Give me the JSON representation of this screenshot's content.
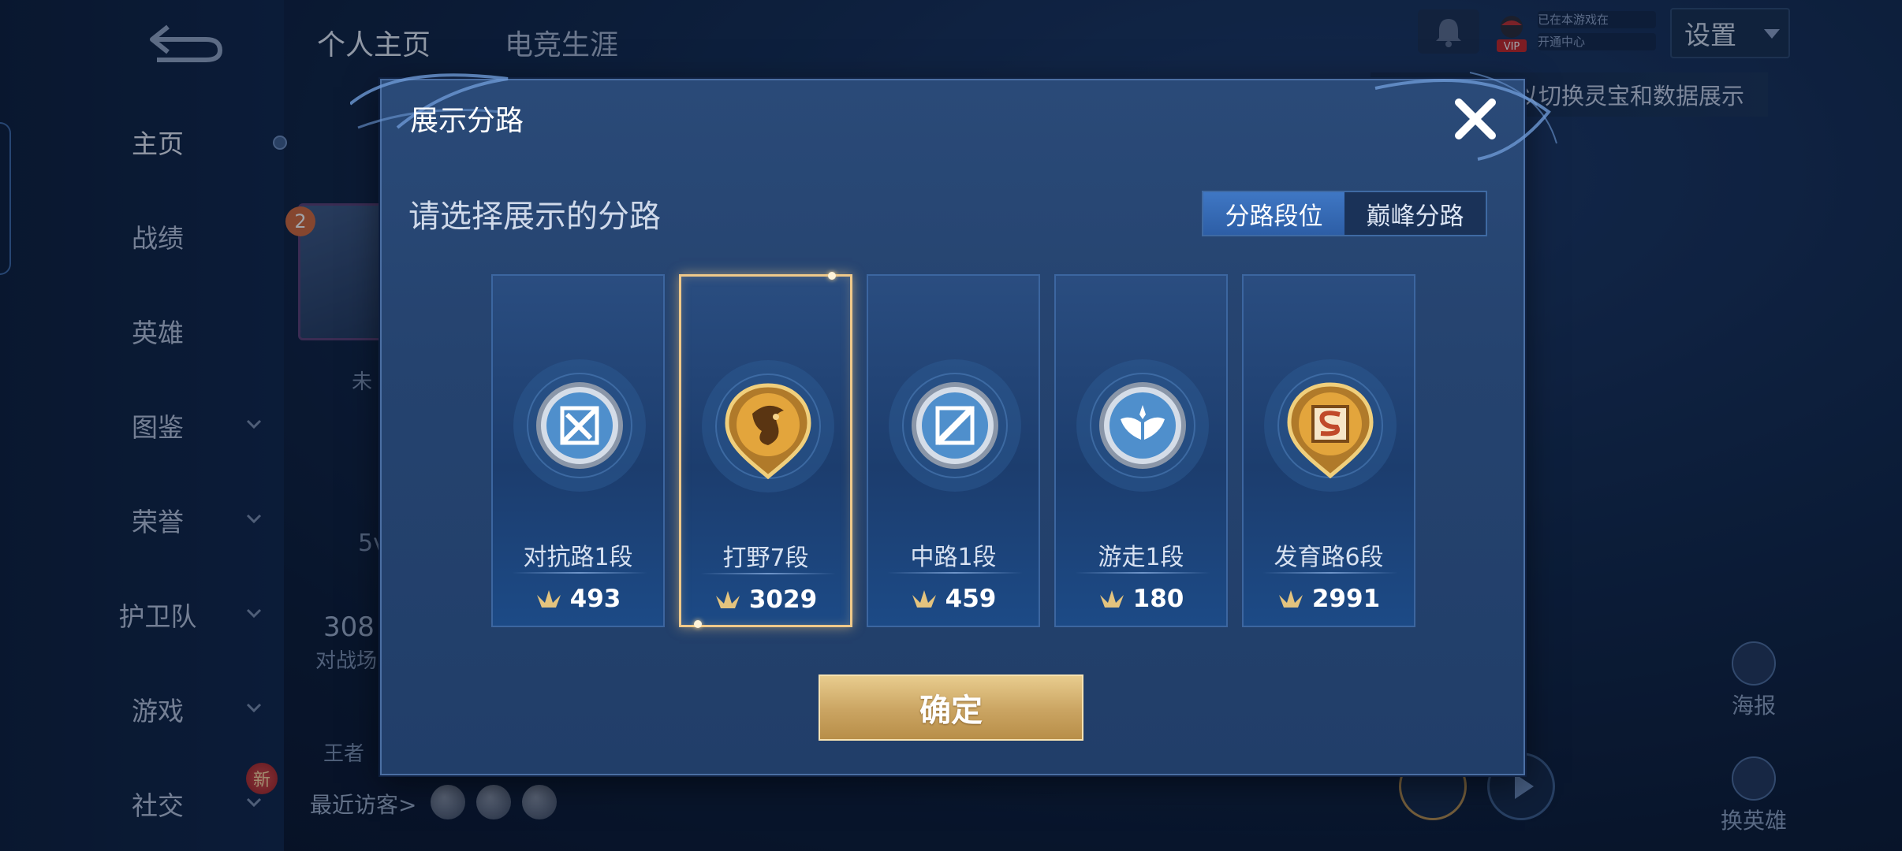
{
  "top_tabs": [
    {
      "label": "个人主页",
      "active": true
    },
    {
      "label": "电竞生涯",
      "active": false
    }
  ],
  "sidebar": {
    "items": [
      {
        "label": "主页",
        "active": true
      },
      {
        "label": "战绩"
      },
      {
        "label": "英雄"
      },
      {
        "label": "图鉴",
        "has_dropdown": true
      },
      {
        "label": "荣誉",
        "has_dropdown": true
      },
      {
        "label": "护卫队",
        "has_dropdown": true
      },
      {
        "label": "游戏",
        "has_dropdown": true
      },
      {
        "label": "社交",
        "has_dropdown": true,
        "badge": "新"
      }
    ]
  },
  "header": {
    "vip_label": "VIP",
    "vip_line1": "已在本游戏在",
    "vip_line2": "开通中心",
    "settings_label": "设置",
    "hint_text": "以切换灵宝和数据展示"
  },
  "background": {
    "level_badge": "2",
    "status_text": "未",
    "mode_text": "5v",
    "stat_value": "308",
    "stat_label": "对战场",
    "king_text": "王者",
    "recent_visitors": "最近访客>",
    "poster_label": "海报",
    "swap_hero_label": "换英雄"
  },
  "modal": {
    "title": "展示分路",
    "subtitle": "请选择展示的分路",
    "segments": [
      {
        "label": "分路段位",
        "active": true
      },
      {
        "label": "巅峰分路",
        "active": false
      }
    ],
    "lanes": [
      {
        "name": "对抗路1段",
        "points": "493",
        "emblem": "clash-lane-emblem-icon",
        "tier": "silver",
        "selected": false
      },
      {
        "name": "打野7段",
        "points": "3029",
        "emblem": "jungle-emblem-icon",
        "tier": "gold",
        "selected": true
      },
      {
        "name": "中路1段",
        "points": "459",
        "emblem": "mid-lane-emblem-icon",
        "tier": "silver",
        "selected": false
      },
      {
        "name": "游走1段",
        "points": "180",
        "emblem": "roam-emblem-icon",
        "tier": "silver",
        "selected": false
      },
      {
        "name": "发育路6段",
        "points": "2991",
        "emblem": "farm-lane-emblem-icon",
        "tier": "gold",
        "selected": false
      }
    ],
    "confirm_label": "确定"
  },
  "colors": {
    "accent_gold": "#caa462",
    "selected_border": "#f0c98a",
    "active_segment": "#3f77c4",
    "modal_bg": "#25436f"
  }
}
